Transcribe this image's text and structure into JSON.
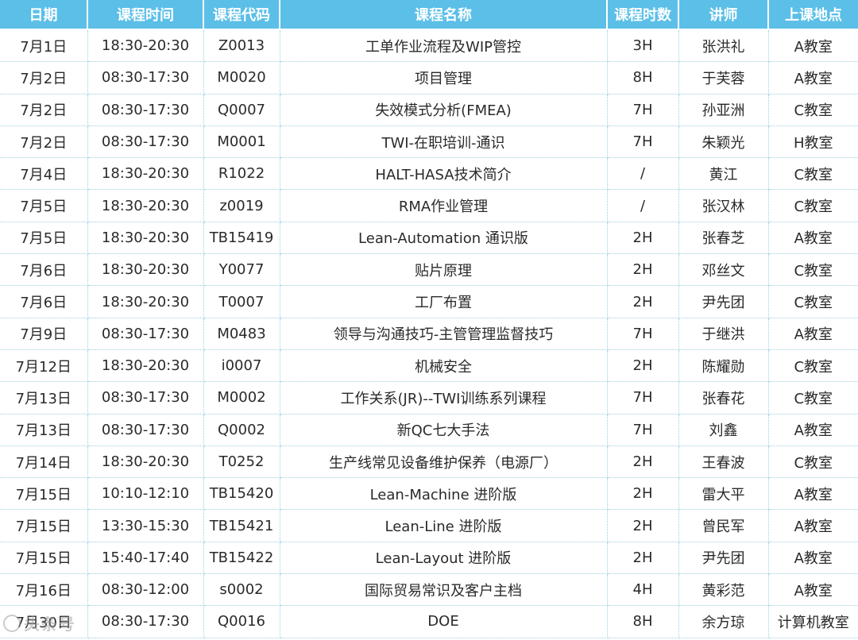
{
  "headers": [
    "日期",
    "课程时间",
    "课程代码",
    "课程名称",
    "课程时数",
    "讲师",
    "上课地点"
  ],
  "rows": [
    [
      "7月1日",
      "18:30-20:30",
      "Z0013",
      "工单作业流程及WIP管控",
      "3H",
      "张洪礼",
      "A教室"
    ],
    [
      "7月2日",
      "08:30-17:30",
      "M0020",
      "项目管理",
      "8H",
      "于芙蓉",
      "A教室"
    ],
    [
      "7月2日",
      "08:30-17:30",
      "Q0007",
      "失效模式分析(FMEA)",
      "7H",
      "孙亚洲",
      "C教室"
    ],
    [
      "7月2日",
      "08:30-17:30",
      "M0001",
      "TWI-在职培训-通识",
      "7H",
      "朱颖光",
      "H教室"
    ],
    [
      "7月4日",
      "18:30-20:30",
      "R1022",
      "HALT-HASA技术简介",
      "/",
      "黄江",
      "C教室"
    ],
    [
      "7月5日",
      "18:30-20:30",
      "z0019",
      "RMA作业管理",
      "/",
      "张汉林",
      "C教室"
    ],
    [
      "7月5日",
      "18:30-20:30",
      "TB15419",
      "Lean-Automation 通识版",
      "2H",
      "张春芝",
      "A教室"
    ],
    [
      "7月6日",
      "18:30-20:30",
      "Y0077",
      "贴片原理",
      "2H",
      "邓丝文",
      "C教室"
    ],
    [
      "7月6日",
      "18:30-20:30",
      "T0007",
      "工厂布置",
      "2H",
      "尹先团",
      "C教室"
    ],
    [
      "7月9日",
      "08:30-17:30",
      "M0483",
      "领导与沟通技巧-主管管理监督技巧",
      "7H",
      "于继洪",
      "A教室"
    ],
    [
      "7月12日",
      "18:30-20:30",
      "i0007",
      "机械安全",
      "2H",
      "陈耀勋",
      "C教室"
    ],
    [
      "7月13日",
      "08:30-17:30",
      "M0002",
      "工作关系(JR)--TWI训练系列课程",
      "7H",
      "张春花",
      "C教室"
    ],
    [
      "7月13日",
      "08:30-17:30",
      "Q0002",
      "新QC七大手法",
      "7H",
      "刘鑫",
      "A教室"
    ],
    [
      "7月14日",
      "18:30-20:30",
      "T0252",
      "生产线常见设备维护保养（电源厂）",
      "2H",
      "王春波",
      "C教室"
    ],
    [
      "7月15日",
      "10:10-12:10",
      "TB15420",
      "Lean-Machine 进阶版",
      "2H",
      "雷大平",
      "A教室"
    ],
    [
      "7月15日",
      "13:30-15:30",
      "TB15421",
      "Lean-Line 进阶版",
      "2H",
      "曾民军",
      "A教室"
    ],
    [
      "7月15日",
      "15:40-17:40",
      "TB15422",
      "Lean-Layout 进阶版",
      "2H",
      "尹先团",
      "A教室"
    ],
    [
      "7月16日",
      "08:30-12:00",
      "s0002",
      "国际贸易常识及客户主档",
      "4H",
      "黄彩范",
      "A教室"
    ],
    [
      "7月30日",
      "08:30-17:30",
      "Q0016",
      "DOE",
      "8H",
      "余方琼",
      "计算机教室"
    ]
  ],
  "watermark": "头条号",
  "colors": {
    "header_bg": "#5bbfe8",
    "header_text": "#ffffff",
    "cell_text": "#2a2a2a",
    "grid_line": "#9ccfe4"
  }
}
